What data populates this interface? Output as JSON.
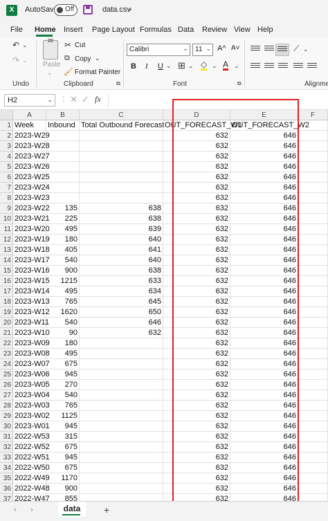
{
  "titlebar": {
    "autosave_label": "AutoSave",
    "toggle_state": "Off",
    "filename": "data.csv"
  },
  "menu": {
    "tabs": [
      "File",
      "Home",
      "Insert",
      "Page Layout",
      "Formulas",
      "Data",
      "Review",
      "View",
      "Help"
    ],
    "active": "Home"
  },
  "ribbon": {
    "undo_label": "Undo",
    "paste_label": "Paste",
    "cut_label": "Cut",
    "copy_label": "Copy",
    "format_painter_label": "Format Painter",
    "clipboard_label": "Clipboard",
    "font_name": "Calibri",
    "font_size": "11",
    "bold": "B",
    "italic": "I",
    "underline": "U",
    "font_label": "Font",
    "alignment_label": "Alignme",
    "grow_font": "A^",
    "shrink_font": "A˅"
  },
  "formula_bar": {
    "name_box": "H2",
    "fx": "fx",
    "formula": ""
  },
  "columns": {
    "headers": [
      "A",
      "B",
      "C",
      "D",
      "E",
      "F"
    ]
  },
  "rows": [
    {
      "n": "1",
      "a": "Week",
      "b": "Inbound",
      "c": "Total Outbound Forecast",
      "d": "OUT_FORECAST_W1",
      "e": "OUT_FORECAST_W2"
    },
    {
      "n": "2",
      "a": "2023-W29",
      "b": "",
      "c": "",
      "d": "632",
      "e": "646"
    },
    {
      "n": "3",
      "a": "2023-W28",
      "b": "",
      "c": "",
      "d": "632",
      "e": "646"
    },
    {
      "n": "4",
      "a": "2023-W27",
      "b": "",
      "c": "",
      "d": "632",
      "e": "646"
    },
    {
      "n": "5",
      "a": "2023-W26",
      "b": "",
      "c": "",
      "d": "632",
      "e": "646"
    },
    {
      "n": "6",
      "a": "2023-W25",
      "b": "",
      "c": "",
      "d": "632",
      "e": "646"
    },
    {
      "n": "7",
      "a": "2023-W24",
      "b": "",
      "c": "",
      "d": "632",
      "e": "646"
    },
    {
      "n": "8",
      "a": "2023-W23",
      "b": "",
      "c": "",
      "d": "632",
      "e": "646"
    },
    {
      "n": "9",
      "a": "2023-W22",
      "b": "135",
      "c": "638",
      "d": "632",
      "e": "646"
    },
    {
      "n": "10",
      "a": "2023-W21",
      "b": "225",
      "c": "638",
      "d": "632",
      "e": "646"
    },
    {
      "n": "11",
      "a": "2023-W20",
      "b": "495",
      "c": "639",
      "d": "632",
      "e": "646"
    },
    {
      "n": "12",
      "a": "2023-W19",
      "b": "180",
      "c": "640",
      "d": "632",
      "e": "646"
    },
    {
      "n": "13",
      "a": "2023-W18",
      "b": "405",
      "c": "641",
      "d": "632",
      "e": "646"
    },
    {
      "n": "14",
      "a": "2023-W17",
      "b": "540",
      "c": "640",
      "d": "632",
      "e": "646"
    },
    {
      "n": "15",
      "a": "2023-W16",
      "b": "900",
      "c": "638",
      "d": "632",
      "e": "646"
    },
    {
      "n": "16",
      "a": "2023-W15",
      "b": "1215",
      "c": "633",
      "d": "632",
      "e": "646"
    },
    {
      "n": "17",
      "a": "2023-W14",
      "b": "495",
      "c": "634",
      "d": "632",
      "e": "646"
    },
    {
      "n": "18",
      "a": "2023-W13",
      "b": "765",
      "c": "645",
      "d": "632",
      "e": "646"
    },
    {
      "n": "19",
      "a": "2023-W12",
      "b": "1620",
      "c": "650",
      "d": "632",
      "e": "646"
    },
    {
      "n": "20",
      "a": "2023-W11",
      "b": "540",
      "c": "646",
      "d": "632",
      "e": "646"
    },
    {
      "n": "21",
      "a": "2023-W10",
      "b": "90",
      "c": "632",
      "d": "632",
      "e": "646"
    },
    {
      "n": "22",
      "a": "2023-W09",
      "b": "180",
      "c": "",
      "d": "632",
      "e": "646"
    },
    {
      "n": "23",
      "a": "2023-W08",
      "b": "495",
      "c": "",
      "d": "632",
      "e": "646"
    },
    {
      "n": "24",
      "a": "2023-W07",
      "b": "675",
      "c": "",
      "d": "632",
      "e": "646"
    },
    {
      "n": "25",
      "a": "2023-W06",
      "b": "945",
      "c": "",
      "d": "632",
      "e": "646"
    },
    {
      "n": "26",
      "a": "2023-W05",
      "b": "270",
      "c": "",
      "d": "632",
      "e": "646"
    },
    {
      "n": "27",
      "a": "2023-W04",
      "b": "540",
      "c": "",
      "d": "632",
      "e": "646"
    },
    {
      "n": "28",
      "a": "2023-W03",
      "b": "765",
      "c": "",
      "d": "632",
      "e": "646"
    },
    {
      "n": "29",
      "a": "2023-W02",
      "b": "1125",
      "c": "",
      "d": "632",
      "e": "646"
    },
    {
      "n": "30",
      "a": "2023-W01",
      "b": "945",
      "c": "",
      "d": "632",
      "e": "646"
    },
    {
      "n": "31",
      "a": "2022-W53",
      "b": "315",
      "c": "",
      "d": "632",
      "e": "646"
    },
    {
      "n": "32",
      "a": "2022-W52",
      "b": "675",
      "c": "",
      "d": "632",
      "e": "646"
    },
    {
      "n": "33",
      "a": "2022-W51",
      "b": "945",
      "c": "",
      "d": "632",
      "e": "646"
    },
    {
      "n": "34",
      "a": "2022-W50",
      "b": "675",
      "c": "",
      "d": "632",
      "e": "646"
    },
    {
      "n": "35",
      "a": "2022-W49",
      "b": "1170",
      "c": "",
      "d": "632",
      "e": "646"
    },
    {
      "n": "36",
      "a": "2022-W48",
      "b": "900",
      "c": "",
      "d": "632",
      "e": "646"
    },
    {
      "n": "37",
      "a": "2022-W47",
      "b": "855",
      "c": "",
      "d": "632",
      "e": "646"
    }
  ],
  "sheets": {
    "active": "data",
    "add_label": "+"
  },
  "colors": {
    "excel_green": "#107c41",
    "highlight_red": "#e02020"
  }
}
